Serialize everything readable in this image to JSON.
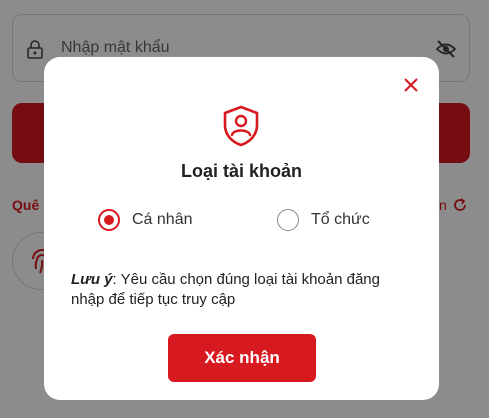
{
  "login": {
    "password_placeholder": "Nhập mật khẩu",
    "forgot_label": "Quê",
    "right_label": "n"
  },
  "modal": {
    "title": "Loại tài khoản",
    "options": [
      {
        "label": "Cá nhân",
        "selected": true
      },
      {
        "label": "Tổ chức",
        "selected": false
      }
    ],
    "note_prefix": "Lưu ý",
    "note_text": ": Yêu cầu chọn đúng loại tài khoản đăng nhập để tiếp tục truy cập",
    "confirm_label": "Xác nhận"
  },
  "colors": {
    "accent": "#d71920",
    "overlay": "rgba(0,0,0,0.45)"
  },
  "icons": [
    "lock-icon",
    "eye-off-icon",
    "refresh-icon",
    "fingerprint-icon",
    "close-icon",
    "user-shield-icon"
  ]
}
